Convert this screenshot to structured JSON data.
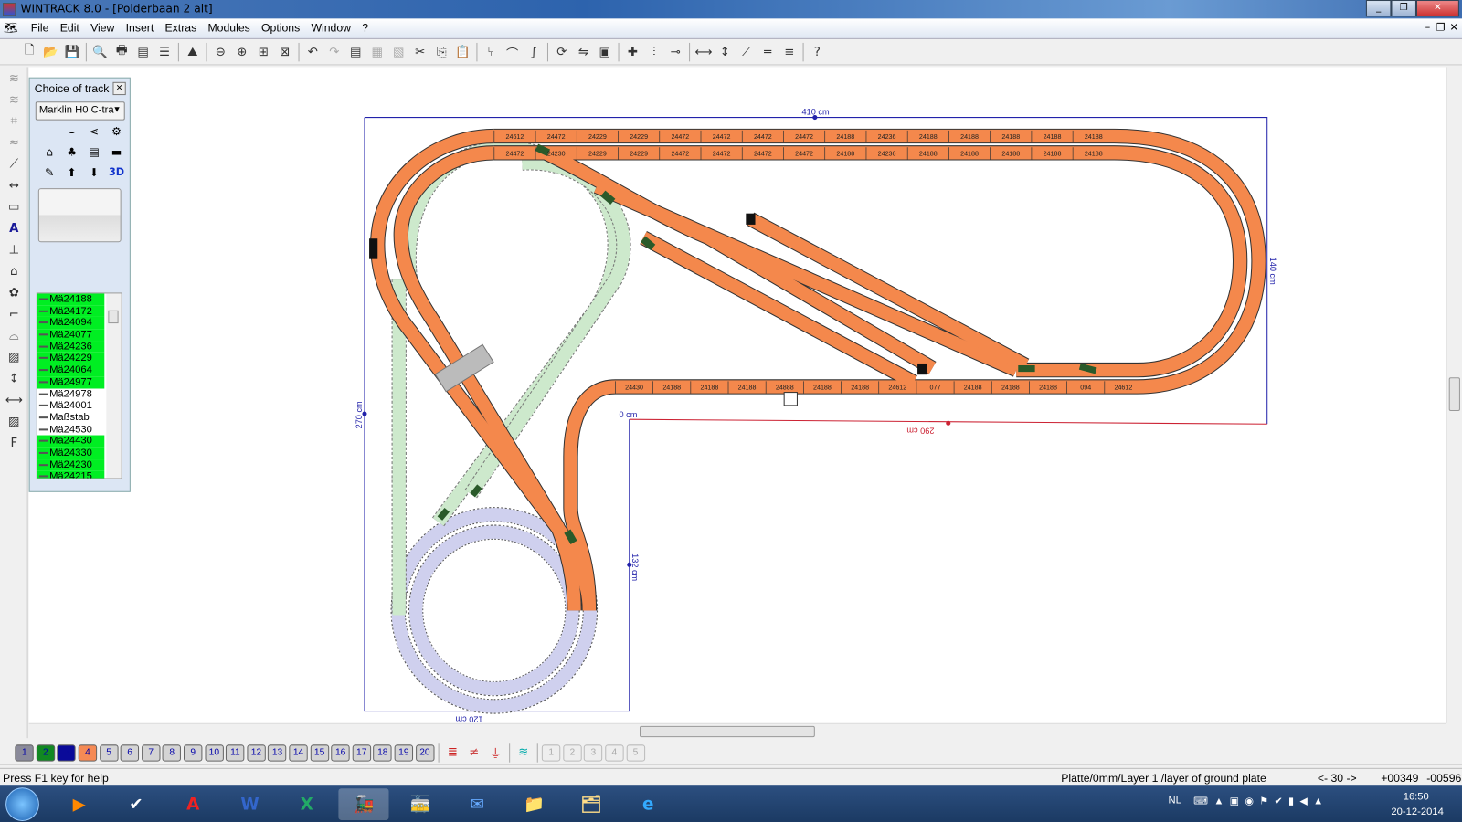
{
  "window": {
    "title": "WINTRACK 8.0 - [Polderbaan 2 alt]",
    "buttons": [
      "minimize",
      "restore",
      "close"
    ]
  },
  "menu": [
    "File",
    "Edit",
    "View",
    "Insert",
    "Extras",
    "Modules",
    "Options",
    "Window",
    "?"
  ],
  "toolbar": [
    "new-icon",
    "open-icon",
    "save-icon",
    "|",
    "print-preview-icon",
    "print-icon",
    "print-setup-icon",
    "parts-list-icon",
    "|",
    "landscape-icon",
    "|",
    "zoom-out-icon",
    "zoom-in-icon",
    "zoom-window-icon",
    "zoom-all-icon",
    "|",
    "undo-icon",
    "redo-icon",
    "delete-icon",
    "copy-disabled-icon",
    "paste-disabled-icon",
    "cut-icon",
    "copy-icon",
    "paste-icon",
    "|",
    "switch-icon",
    "curve-icon",
    "flex-icon",
    "|",
    "rotate-icon",
    "mirror-icon",
    "group-icon",
    "|",
    "connect-icon",
    "split-icon",
    "join-icon",
    "|",
    "measure-icon",
    "height-icon",
    "gradient-icon",
    "track-icon",
    "align-icon",
    "|",
    "help-icon"
  ],
  "left_tools": [
    "flex-track-icon",
    "flex-track-2-icon",
    "bridge-icon",
    "tunnel-icon",
    "wire-icon",
    "dimension-icon",
    "frame-icon",
    "text-icon",
    "height-marker-icon",
    "building-icon",
    "landscape-icon",
    "stairs-icon",
    "terrain-icon",
    "picture-icon",
    "spacing-icon",
    "measure-icon",
    "hatch-icon",
    "support-icon"
  ],
  "track_panel": {
    "title": "Choice of track",
    "system": "Marklin H0 C-tra",
    "icons": [
      "straight-track-icon",
      "curve-track-icon",
      "switch-icon",
      "turntable-icon",
      "signal-icon",
      "tree-icon",
      "platform-icon",
      "terrain-icon",
      "paint-icon",
      "up-icon",
      "down-icon",
      "3d-icon"
    ],
    "three_d_label": "3D",
    "parts": [
      {
        "label": "Mä24188",
        "used": true
      },
      {
        "label": "Mä24172",
        "used": true
      },
      {
        "label": "Mä24094",
        "used": true
      },
      {
        "label": "Mä24077",
        "used": true
      },
      {
        "label": "Mä24236",
        "used": true
      },
      {
        "label": "Mä24229",
        "used": true
      },
      {
        "label": "Mä24064",
        "used": true
      },
      {
        "label": "Mä24977",
        "used": true
      },
      {
        "label": "Mä24978",
        "used": false
      },
      {
        "label": "Mä24001",
        "used": false
      },
      {
        "label": "Maßstab",
        "used": false
      },
      {
        "label": "Mä24530",
        "used": false
      },
      {
        "label": "Mä24430",
        "used": true
      },
      {
        "label": "Mä24330",
        "used": true
      },
      {
        "label": "Mä24230",
        "used": true
      },
      {
        "label": "Mä24215",
        "used": true
      }
    ]
  },
  "layout": {
    "dimensions": {
      "top": "410 cm",
      "right": "140 cm",
      "left": "270 cm",
      "origin": "0 cm",
      "inner_right": "132 cm",
      "bottom": "120 cm",
      "inner_bottom": "290 cm"
    },
    "row1": [
      "24612",
      "24472",
      "24229",
      "24229",
      "24472",
      "24472",
      "24472",
      "24472",
      "24188",
      "24236",
      "24188",
      "24188",
      "24188",
      "24188",
      "24188"
    ],
    "row2": [
      "24472",
      "24230",
      "24229",
      "24229",
      "24472",
      "24472",
      "24472",
      "24472",
      "24188",
      "24236",
      "24188",
      "24188",
      "24188",
      "24188",
      "24188"
    ],
    "row3": [
      "24430",
      "24188",
      "24188",
      "24188",
      "24888",
      "24188",
      "24188",
      "24612",
      "077",
      "24188",
      "24188",
      "24188",
      "094",
      "24612"
    ],
    "colors": {
      "active_track": "#f4884c",
      "green_layer": "#cde9cc",
      "lavender_layer": "#cfd0ee",
      "board": "#2222aa",
      "inner_board": "#cc2233"
    }
  },
  "layers": [
    "1",
    "2",
    "3",
    "4",
    "5",
    "6",
    "7",
    "8",
    "9",
    "10",
    "11",
    "12",
    "13",
    "14",
    "15",
    "16",
    "17",
    "18",
    "19",
    "20"
  ],
  "layer_colors": {
    "1": "#8a8a9a",
    "2": "#118822",
    "3": "#0a0a99",
    "4": "#f58a55"
  },
  "modules": [
    "1",
    "2",
    "3",
    "4",
    "5"
  ],
  "status": {
    "help": "Press F1 key for help",
    "layer": "Platte/0mm/Layer 1 /layer of ground plate",
    "angle": "<- 30 ->",
    "x": "+00349",
    "y": "-00596"
  },
  "taskbar": {
    "apps": [
      "media-player-icon",
      "tasks-icon",
      "acrobat-icon",
      "word-icon",
      "excel-icon",
      "wintrack-icon",
      "train-icon",
      "mail-icon",
      "explorer-icon",
      "folder-icon",
      "ie-icon"
    ],
    "lang": "NL",
    "time": "16:50",
    "date": "20-12-2014"
  }
}
